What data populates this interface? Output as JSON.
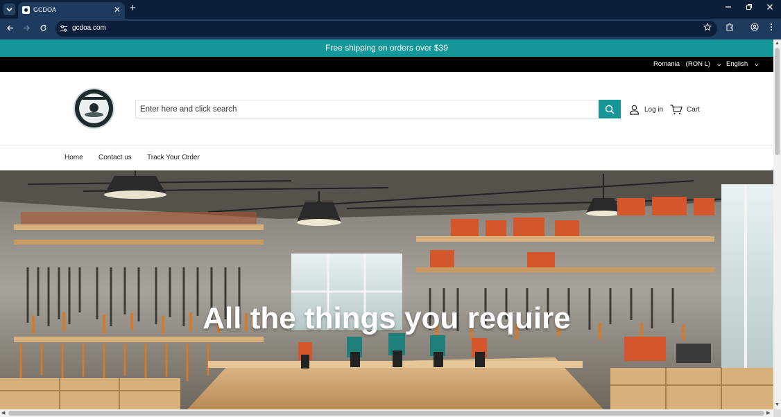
{
  "browser": {
    "tab_title": "GCDOA",
    "tab_close_glyph": "✕",
    "new_tab_glyph": "+",
    "url": "gcdoa.com",
    "icons": {
      "tab_search": "chevron-down-icon",
      "back": "arrow-left-icon",
      "forward": "arrow-right-icon",
      "reload": "reload-icon",
      "site_info": "tune-icon",
      "bookmark": "star-icon",
      "extensions": "puzzle-icon",
      "profile": "account-circle-icon",
      "menu": "kebab-menu-icon",
      "minimize": "minimize-icon",
      "restore": "restore-icon",
      "close": "close-icon"
    }
  },
  "announcement": {
    "text": "Free shipping on orders over $39"
  },
  "utility_bar": {
    "country": "Romania",
    "currency": "(RON L)",
    "language": "English"
  },
  "header": {
    "search_placeholder": "Enter here and click search",
    "login_label": "Log in",
    "cart_label": "Cart"
  },
  "menu": {
    "items": [
      {
        "label": "Home"
      },
      {
        "label": "Contact us"
      },
      {
        "label": "Track Your Order"
      }
    ]
  },
  "hero": {
    "title": "All the things you require"
  },
  "colors": {
    "brand": "#15979a",
    "chrome_dark": "#0b1f3a",
    "chrome_mid": "#1e3a5c"
  }
}
